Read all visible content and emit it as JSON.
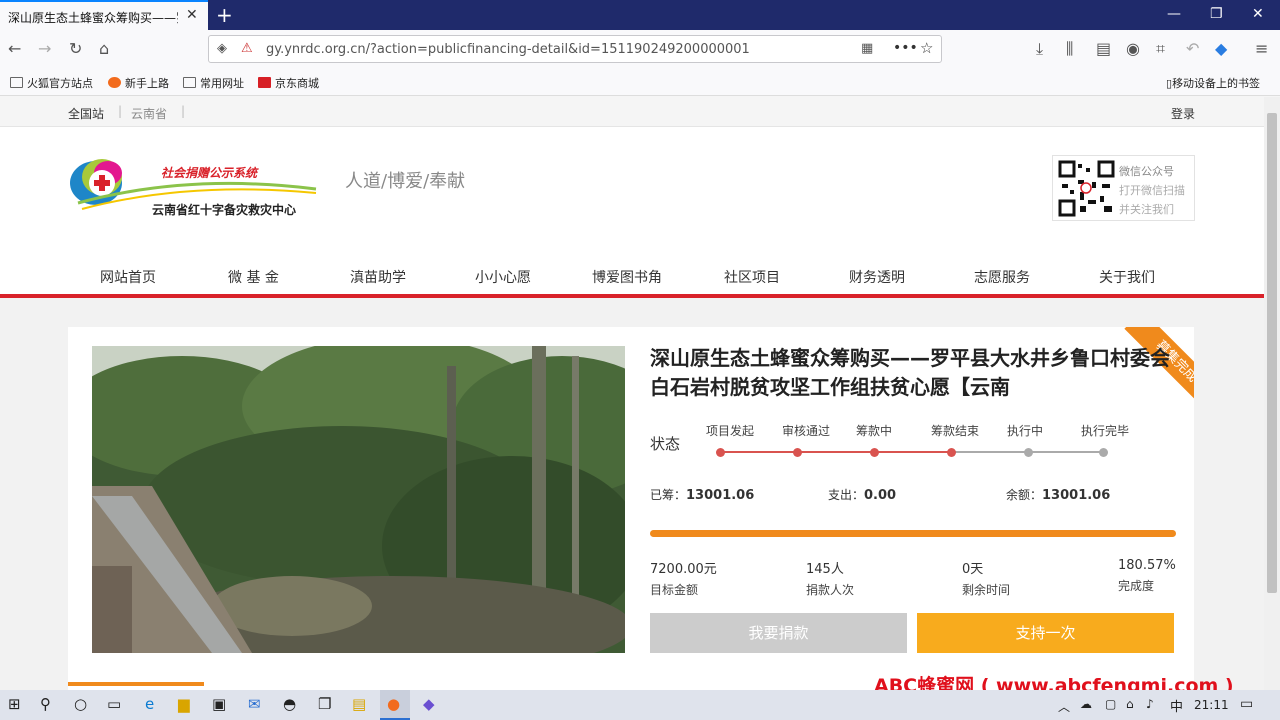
{
  "browser": {
    "tab_title": "深山原生态土蜂蜜众筹购买——罗",
    "tab_close": "✕",
    "new_tab": "+",
    "url": "gy.ynrdc.org.cn/?action=publicfinancing-detail&id=151190249200000001",
    "bookmarks": [
      "火狐官方站点",
      "新手上路",
      "常用网址",
      "京东商城"
    ],
    "mobile_bookmarks": "移动设备上的书签"
  },
  "topbar": {
    "site_all": "全国站",
    "site_province": "云南省",
    "separator": "|",
    "login": "登录"
  },
  "header": {
    "logo_line1": "社会捐赠公示系统",
    "logo_line2": "云南省红十字备灾救灾中心",
    "slogan": "人道/博爱/奉献",
    "wechat": [
      "微信公众号",
      "打开微信扫描",
      "并关注我们"
    ]
  },
  "nav": [
    "网站首页",
    "微 基 金",
    "滇苗助学",
    "小小心愿",
    "博爱图书角",
    "社区项目",
    "财务透明",
    "志愿服务",
    "关于我们"
  ],
  "project": {
    "badge": "募集完成",
    "title": "深山原生态土蜂蜜众筹购买——罗平县大水井乡鲁口村委会白石岩村脱贫攻坚工作组扶贫心愿【云南",
    "status_label": "状态",
    "steps": [
      "项目发起",
      "审核通过",
      "筹款中",
      "筹款结束",
      "执行中",
      "执行完毕"
    ],
    "steps_done": 4,
    "raised_label": "已筹：",
    "raised": "13001.06",
    "spent_label": "支出：",
    "spent": "0.00",
    "balance_label": "余额：",
    "balance": "13001.06",
    "progress_fraction": 1.0,
    "metrics": [
      {
        "value": "7200.00元",
        "label": "目标金额"
      },
      {
        "value": "145人",
        "label": "捐款人次"
      },
      {
        "value": "0天",
        "label": "剩余时间"
      },
      {
        "value": "180.57%",
        "label": "完成度"
      }
    ],
    "donate_button": "我要捐款",
    "support_button": "支持一次"
  },
  "watermark": "ABC蜂蜜网 ( www.abcfengmi.com )",
  "taskbar": {
    "ime": "中",
    "time": "21:11"
  },
  "colors": {
    "accent_red": "#d9222a",
    "accent_orange": "#f08a1c",
    "step_done": "#d9534f",
    "step_todo": "#aaaaaa",
    "disabled_button": "#cccccc"
  }
}
